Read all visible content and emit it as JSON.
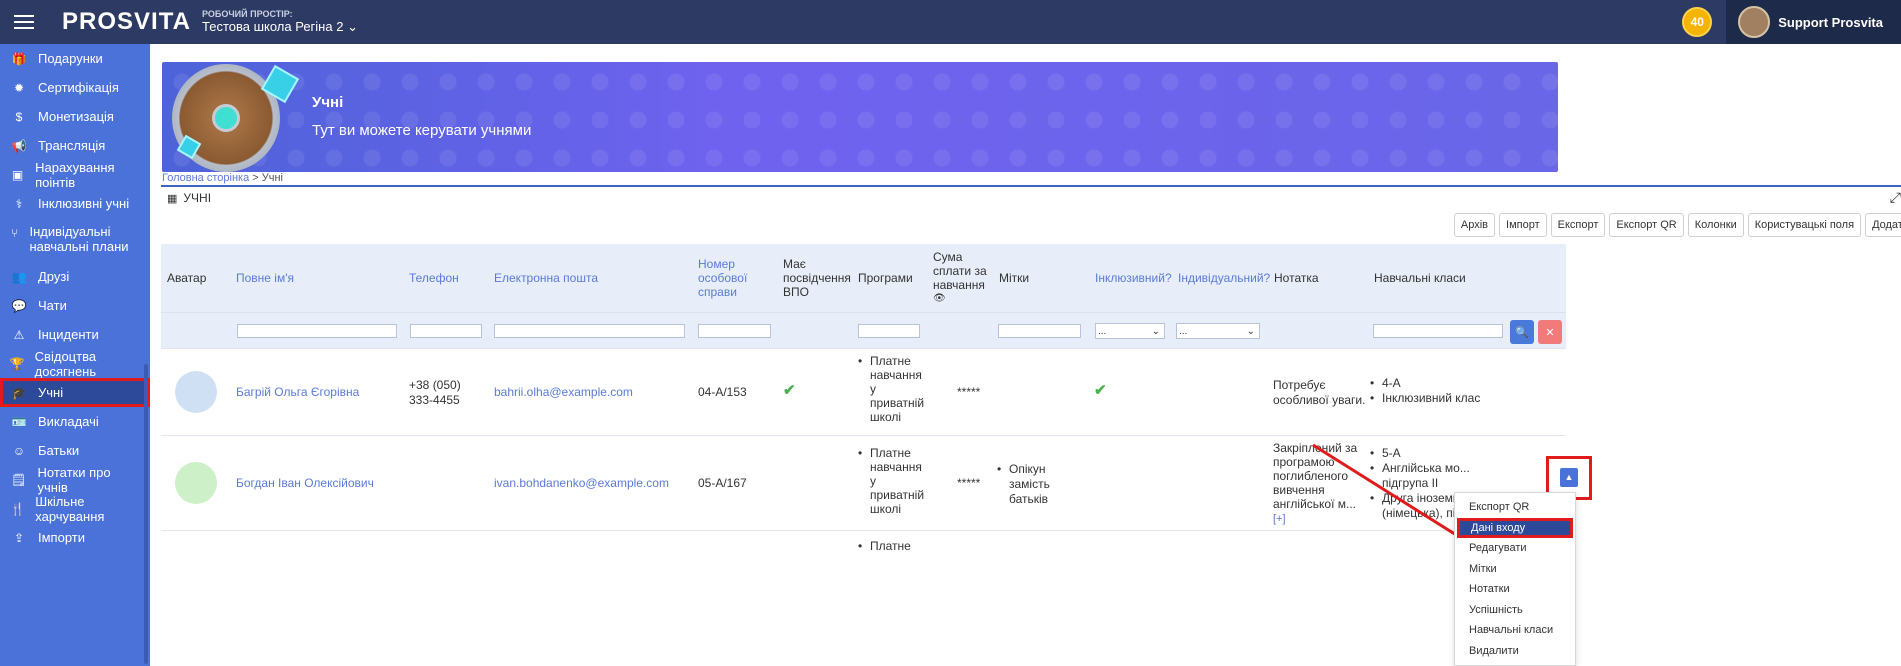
{
  "topbar": {
    "logo": "PROSVITA",
    "workspace_label": "РОБОЧИЙ ПРОСТІР:",
    "workspace_value": "Тестова школа Регіна 2",
    "coins": "40",
    "user_name": "Support Prosvita"
  },
  "sidebar": {
    "items": [
      {
        "label": "Подарунки",
        "icon": "gift-icon"
      },
      {
        "label": "Сертифікація",
        "icon": "certificate-icon"
      },
      {
        "label": "Монетизація",
        "icon": "dollar-icon"
      },
      {
        "label": "Трансляція",
        "icon": "megaphone-icon"
      },
      {
        "label": "Нарахування поінтів",
        "icon": "money-icon"
      },
      {
        "label": "Інклюзивні учні",
        "icon": "stethoscope-icon"
      },
      {
        "label": "Індивідуальні навчальні плани",
        "icon": "branch-icon"
      },
      {
        "label": "Друзі",
        "icon": "users-icon"
      },
      {
        "label": "Чати",
        "icon": "chat-icon"
      },
      {
        "label": "Інциденти",
        "icon": "warning-icon"
      },
      {
        "label": "Свідоцтва досягнень",
        "icon": "trophy-icon"
      },
      {
        "label": "Учні",
        "icon": "graduation-cap-icon"
      },
      {
        "label": "Викладачі",
        "icon": "id-card-icon"
      },
      {
        "label": "Батьки",
        "icon": "smile-icon"
      },
      {
        "label": "Нотатки про учнів",
        "icon": "note-icon"
      },
      {
        "label": "Шкільне харчування",
        "icon": "cutlery-icon"
      },
      {
        "label": "Імпорти",
        "icon": "upload-icon"
      }
    ]
  },
  "banner": {
    "title": "Учні",
    "subtitle": "Тут ви можете керувати учнями"
  },
  "breadcrumb": {
    "home": "Головна сторінка",
    "separator": " > ",
    "current": "Учні"
  },
  "panel": {
    "title": "УЧНІ"
  },
  "toolbar": {
    "buttons": [
      "Архів",
      "Імпорт",
      "Експорт",
      "Експорт QR",
      "Колонки",
      "Користувацькі поля",
      "Додати"
    ]
  },
  "table": {
    "headers": {
      "avatar": "Аватар",
      "full_name": "Повне ім'я",
      "phone": "Телефон",
      "email": "Електронна пошта",
      "record_number": "Номер особової справи",
      "vpo": "Має посвідчення ВПО",
      "programs": "Програми",
      "tuition": "Сума сплати за навчання",
      "tags": "Мітки",
      "inclusive": "Інклюзивний?",
      "individual": "Індивідуальний?",
      "note": "Нотатка",
      "classes": "Навчальні класи"
    },
    "filter_select_placeholder": "...",
    "rows": [
      {
        "full_name": "Багрій Ольга Єгорівна",
        "phone": "+38 (050) 333-4455",
        "email": "bahrii.olha@example.com",
        "record_number": "04-А/153",
        "vpo": "✔",
        "program": "Платне навчання у приватній школі",
        "tuition": "*****",
        "tag": "",
        "inclusive": "✔",
        "note": "Потребує особливої уваги.",
        "classes": [
          "4-А",
          "Інклюзивний клас"
        ]
      },
      {
        "full_name": "Богдан Іван Олексійович",
        "phone": "",
        "email": "ivan.bohdanenko@example.com",
        "record_number": "05-А/167",
        "vpo": "",
        "program": "Платне навчання у приватній школі",
        "tuition": "*****",
        "tag": "Опікун замість батьків",
        "inclusive": "",
        "note": "Закріплений за програмою поглибленого вивчення англійської м...",
        "note_more": "[+]",
        "classes": [
          "5-А",
          "Англійська мо... підгрупа II",
          "Друга іноземн... (німецька), під..."
        ]
      },
      {
        "program": "Платне"
      }
    ]
  },
  "dropdown": {
    "items": [
      "Експорт QR",
      "Дані входу",
      "Редагувати",
      "Мітки",
      "Нотатки",
      "Успішність",
      "Навчальні класи",
      "Видалити"
    ]
  },
  "colors": {
    "topbar": "#2d3a63",
    "sidebar": "#4a72d9",
    "accent": "#3c64c8",
    "highlight_outline": "#e01b1b",
    "check": "#4caf50"
  }
}
